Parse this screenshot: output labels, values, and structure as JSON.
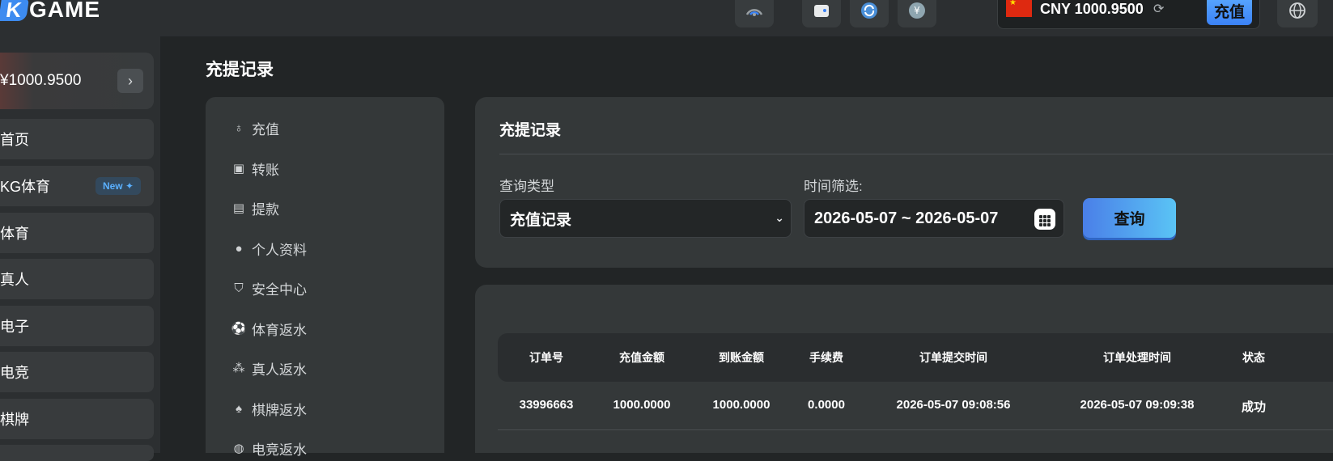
{
  "header": {
    "logo_mark": "K",
    "logo_text": "GAME",
    "currency_balance": "CNY 1000.9500",
    "deposit_label": "充值"
  },
  "sidebar": {
    "balance": "¥1000.9500",
    "items": [
      {
        "label": "首页"
      },
      {
        "label": "KG体育",
        "badge": "New ✦"
      },
      {
        "label": "体育"
      },
      {
        "label": "真人"
      },
      {
        "label": "电子"
      },
      {
        "label": "电竞"
      },
      {
        "label": "棋牌"
      }
    ]
  },
  "page": {
    "title": "充提记录"
  },
  "menu": {
    "items": [
      {
        "label": "充值",
        "icon": "piggy-bank-icon"
      },
      {
        "label": "转账",
        "icon": "transfer-icon"
      },
      {
        "label": "提款",
        "icon": "withdraw-icon"
      },
      {
        "label": "个人资料",
        "icon": "user-icon"
      },
      {
        "label": "安全中心",
        "icon": "shield-icon"
      },
      {
        "label": "体育返水",
        "icon": "soccer-ball-icon"
      },
      {
        "label": "真人返水",
        "icon": "chips-icon"
      },
      {
        "label": "棋牌返水",
        "icon": "cards-icon"
      },
      {
        "label": "电竞返水",
        "icon": "gamepad-icon"
      }
    ]
  },
  "filter": {
    "title": "充提记录",
    "type_label": "查询类型",
    "type_value": "充值记录",
    "time_label": "时间筛选:",
    "date_range": "2026-05-07 ~ 2026-05-07",
    "query_label": "查询"
  },
  "table": {
    "columns": [
      "订单号",
      "充值金额",
      "到账金额",
      "手续费",
      "订单提交时间",
      "订单处理时间",
      "状态"
    ],
    "rows": [
      [
        "33996663",
        "1000.0000",
        "1000.0000",
        "0.0000",
        "2026-05-07 09:08:56",
        "2026-05-07 09:09:38",
        "成功"
      ]
    ]
  },
  "colors": {
    "accent_blue": "#3b82f6",
    "badge_blue": "#5ab0ff",
    "panel_bg": "#343839",
    "page_bg": "#222526"
  }
}
